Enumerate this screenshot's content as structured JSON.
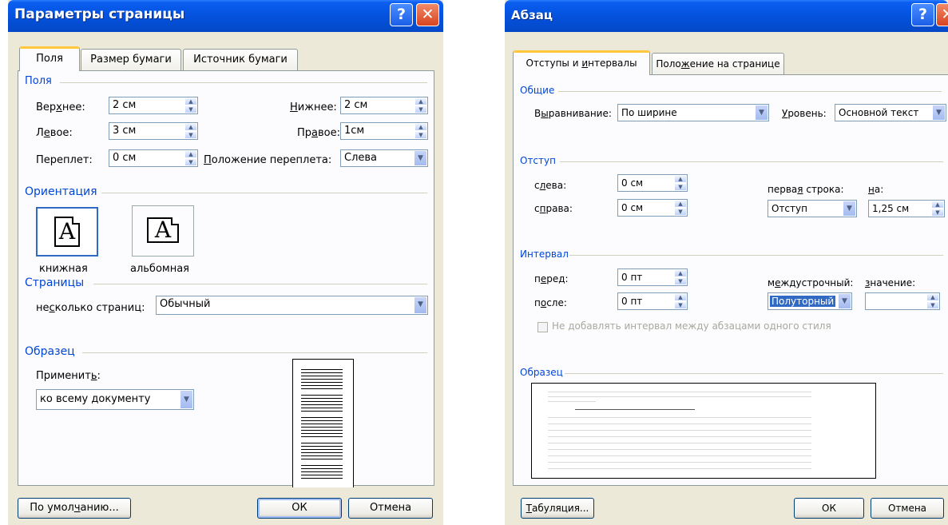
{
  "page_setup": {
    "title": "Параметры страницы",
    "tabs": [
      "Поля",
      "Размер бумаги",
      "Источник бумаги"
    ],
    "margins_group": "Поля",
    "top_label_pre": "Вер",
    "top_label_acc": "х",
    "top_label_post": "нее:",
    "top_value": "2 см",
    "bottom_label_pre": "",
    "bottom_label_acc": "Н",
    "bottom_label_post": "ижнее:",
    "bottom_value": "2 см",
    "left_label_pre": "Л",
    "left_label_acc": "е",
    "left_label_post": "вое:",
    "left_value": "3 см",
    "right_label_pre": "Пр",
    "right_label_acc": "а",
    "right_label_post": "вое:",
    "right_value": "1см",
    "gutter_label_pre": "Переплет",
    "gutter_label_acc": "",
    "gutter_label_post": ":",
    "gutter_value": "0 см",
    "gutter_pos_label_pre": "",
    "gutter_pos_label_acc": "П",
    "gutter_pos_label_post": "оложение переплета:",
    "gutter_pos_value": "Слева",
    "orientation_group": "Ориентация",
    "portrait_label": "книжная",
    "landscape_label": "альбомная",
    "pages_group": "Страницы",
    "multiple_pages_label_pre": "не",
    "multiple_pages_label_acc": "с",
    "multiple_pages_label_post": "колько страниц:",
    "multiple_pages_value": "Обычный",
    "preview_group": "Образец",
    "apply_label_pre": "Применит",
    "apply_label_acc": "ь",
    "apply_label_post": ":",
    "apply_value": "ко всему документу",
    "default_button_pre": "По умол",
    "default_button_acc": "ч",
    "default_button_post": "анию...",
    "ok_button": "ОК",
    "cancel_button": "Отмена",
    "icon_glyph": "A"
  },
  "paragraph": {
    "title": "Абзац",
    "tabs_1_pre": "Отступы и ",
    "tabs_1_acc": "и",
    "tabs_1_post": "нтервалы",
    "tabs_2_pre": "Поло",
    "tabs_2_acc": "ж",
    "tabs_2_post": "ение на странице",
    "general_group": "Общие",
    "alignment_label_pre": "В",
    "alignment_label_acc": "ы",
    "alignment_label_post": "равнивание:",
    "alignment_value": "По ширине",
    "level_label_pre": "",
    "level_label_acc": "У",
    "level_label_post": "ровень:",
    "level_value": "Основной текст",
    "indent_group": "Отступ",
    "left_label_pre": "с",
    "left_label_acc": "л",
    "left_label_post": "ева:",
    "left_value": "0 см",
    "right_label_pre": "с",
    "right_label_acc": "п",
    "right_label_post": "рава:",
    "right_value": "0 см",
    "first_line_label_pre": "перва",
    "first_line_label_acc": "я",
    "first_line_label_post": " строка:",
    "first_line_value": "Отступ",
    "by_label_pre": "",
    "by_label_acc": "н",
    "by_label_post": "а:",
    "by_value": "1,25 см",
    "spacing_group": "Интервал",
    "before_label_pre": "п",
    "before_label_acc": "е",
    "before_label_post": "ред:",
    "before_value": "0 пт",
    "after_label_pre": "п",
    "after_label_acc": "о",
    "after_label_post": "сле:",
    "after_value": "0 пт",
    "line_spacing_label_pre": "м",
    "line_spacing_label_acc": "е",
    "line_spacing_label_post": "ждустрочный:",
    "line_spacing_value": "Полуторный",
    "value_label_pre": "",
    "value_label_acc": "з",
    "value_label_post": "начение:",
    "value_value": "",
    "no_space_checkbox": "Не добавлять интервал между абзацами одного стиля",
    "preview_group": "Образец",
    "tabs_button_pre": "",
    "tabs_button_acc": "Т",
    "tabs_button_post": "абуляция...",
    "ok_button": "ОК",
    "cancel_button": "Отмена"
  },
  "colors": {
    "title_blue": "#0553e0",
    "group_label": "#0046d5",
    "dialog_bg": "#ece9d8",
    "selection": "#316ac5"
  }
}
